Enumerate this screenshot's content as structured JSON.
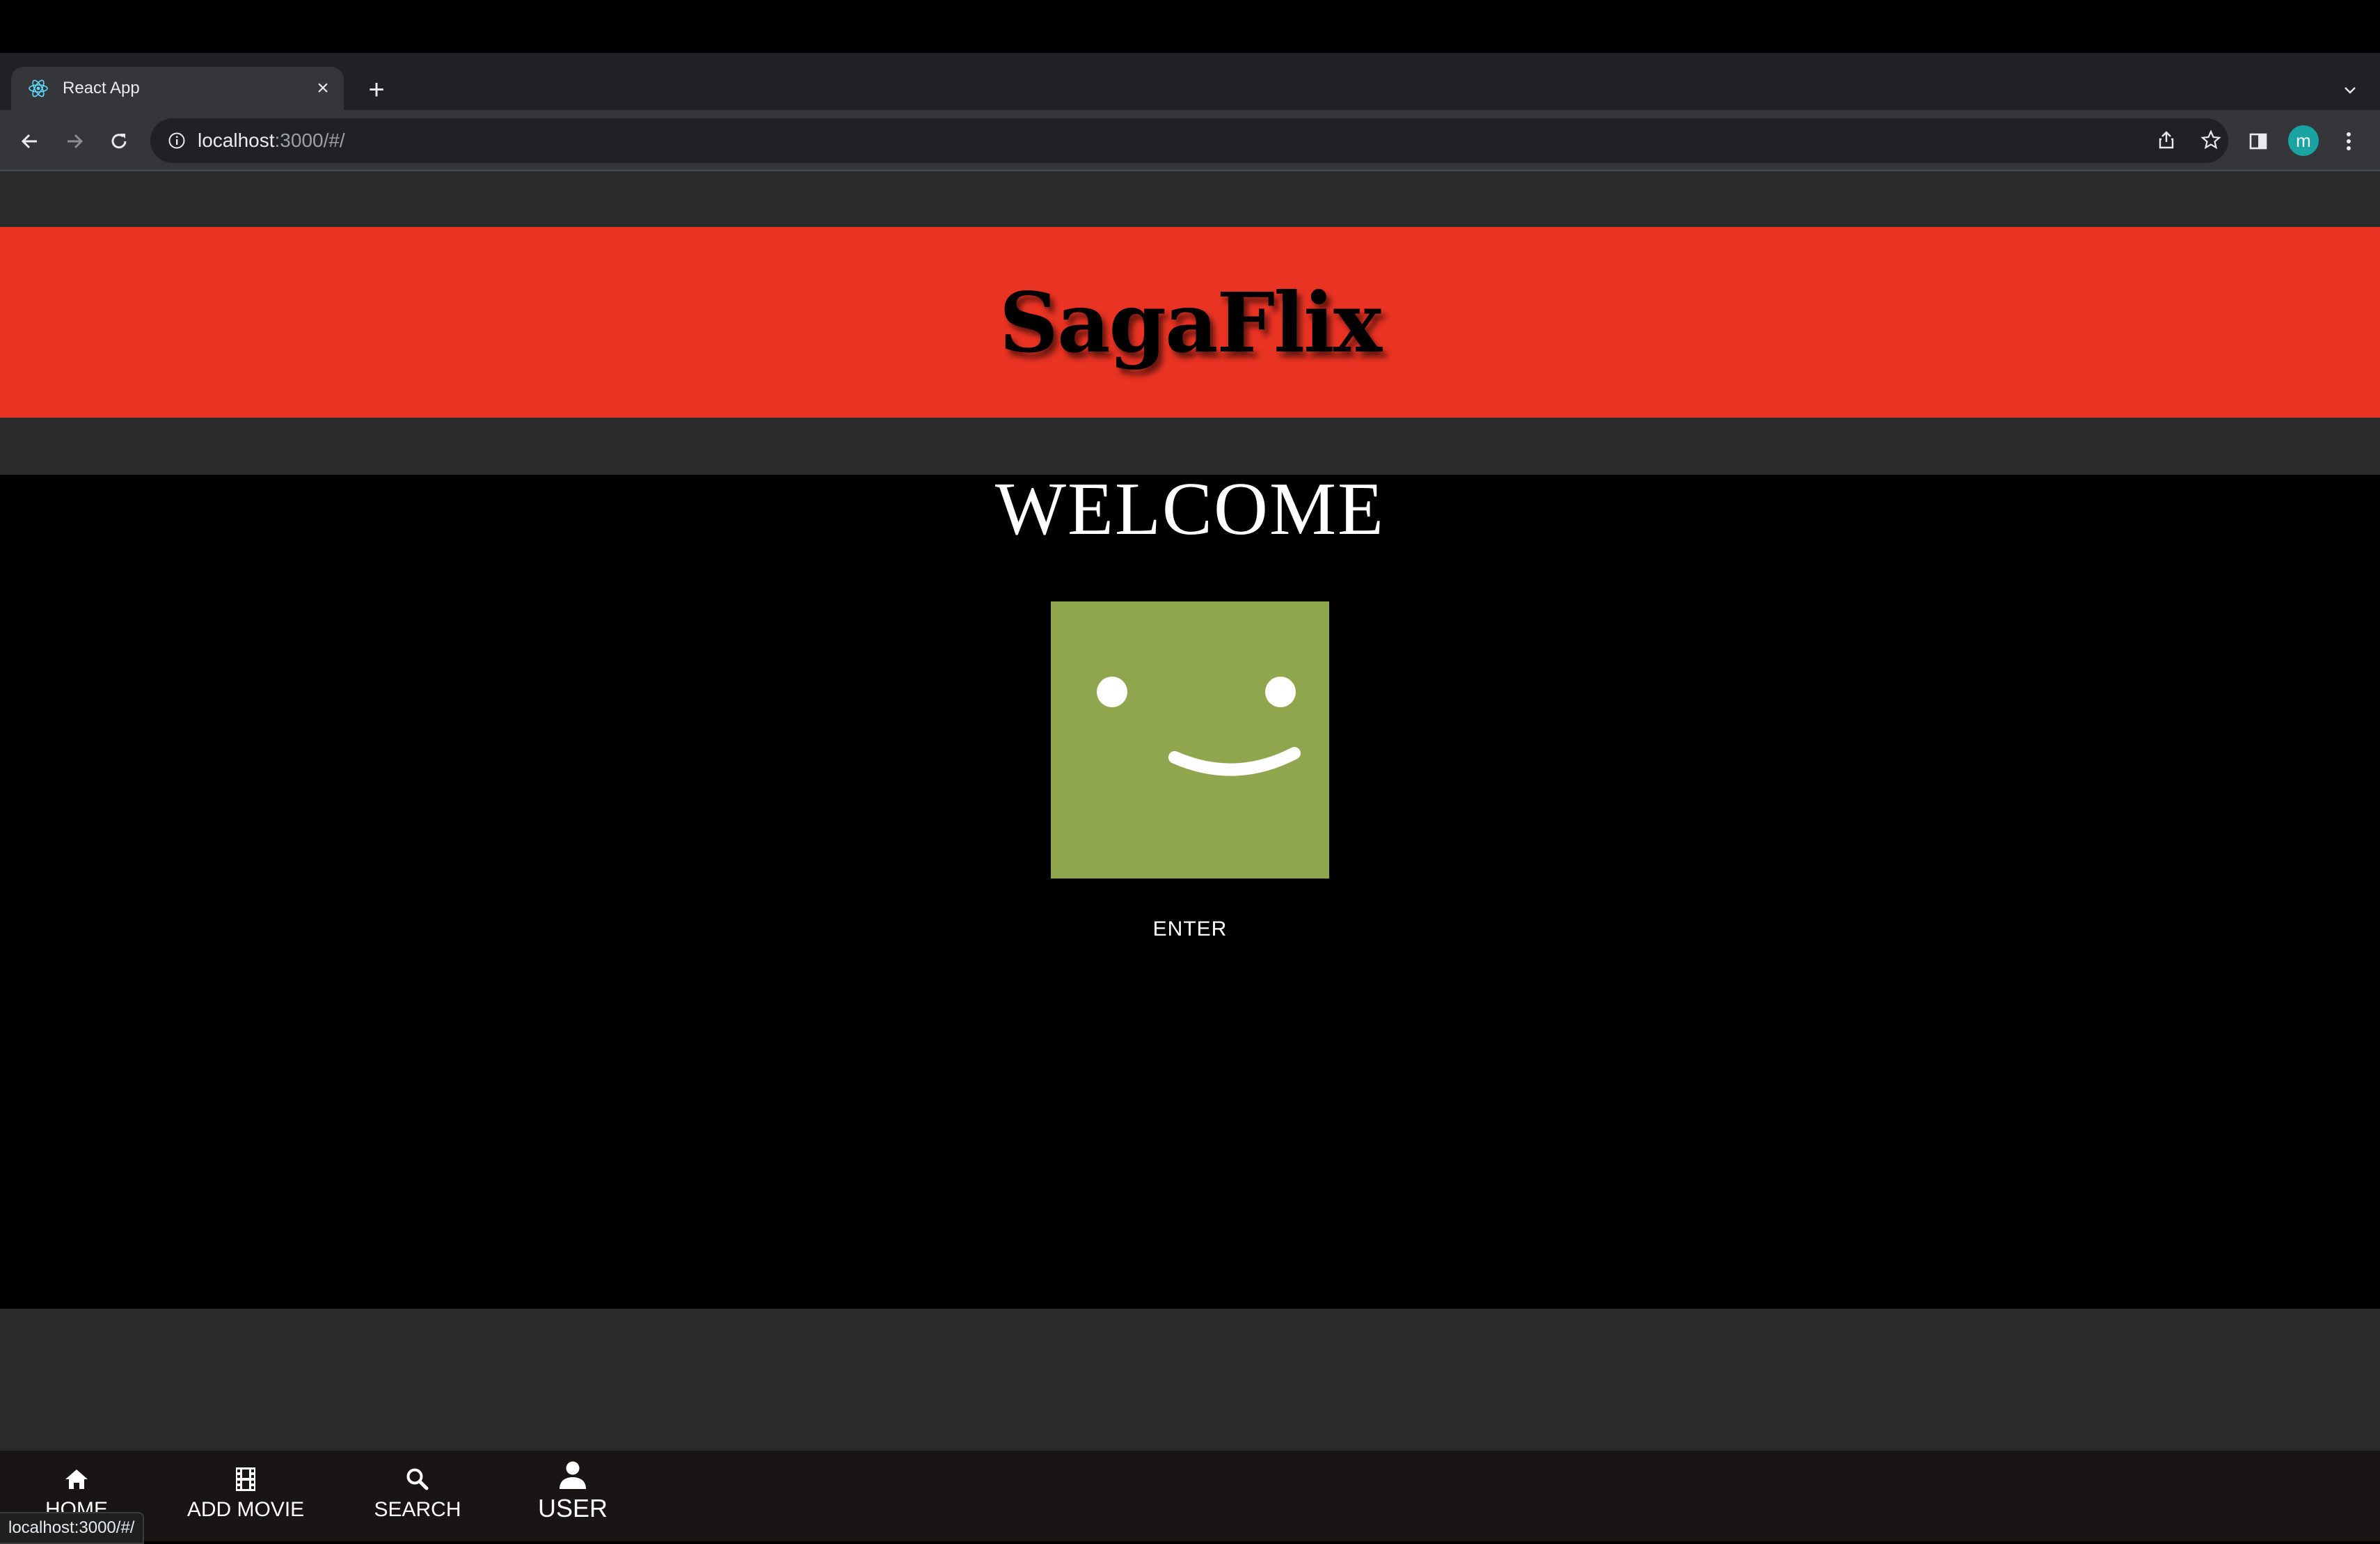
{
  "browser": {
    "tab": {
      "title": "React App"
    },
    "url": {
      "host": "localhost",
      "path": ":3000/#/"
    },
    "profile_initial": "m"
  },
  "app": {
    "brand": "SagaFlix",
    "welcome": "WELCOME",
    "enter_label": "ENTER",
    "colors": {
      "header": "#e93323",
      "smiley_bg": "#8fa64f",
      "background": "#000000"
    }
  },
  "bottom_nav": {
    "items": [
      {
        "label": "HOME",
        "icon": "home-icon"
      },
      {
        "label": "ADD MOVIE",
        "icon": "movie-icon"
      },
      {
        "label": "SEARCH",
        "icon": "search-icon"
      },
      {
        "label": "USER",
        "icon": "person-icon"
      }
    ]
  },
  "status_bar": {
    "url": "localhost:3000/#/"
  }
}
